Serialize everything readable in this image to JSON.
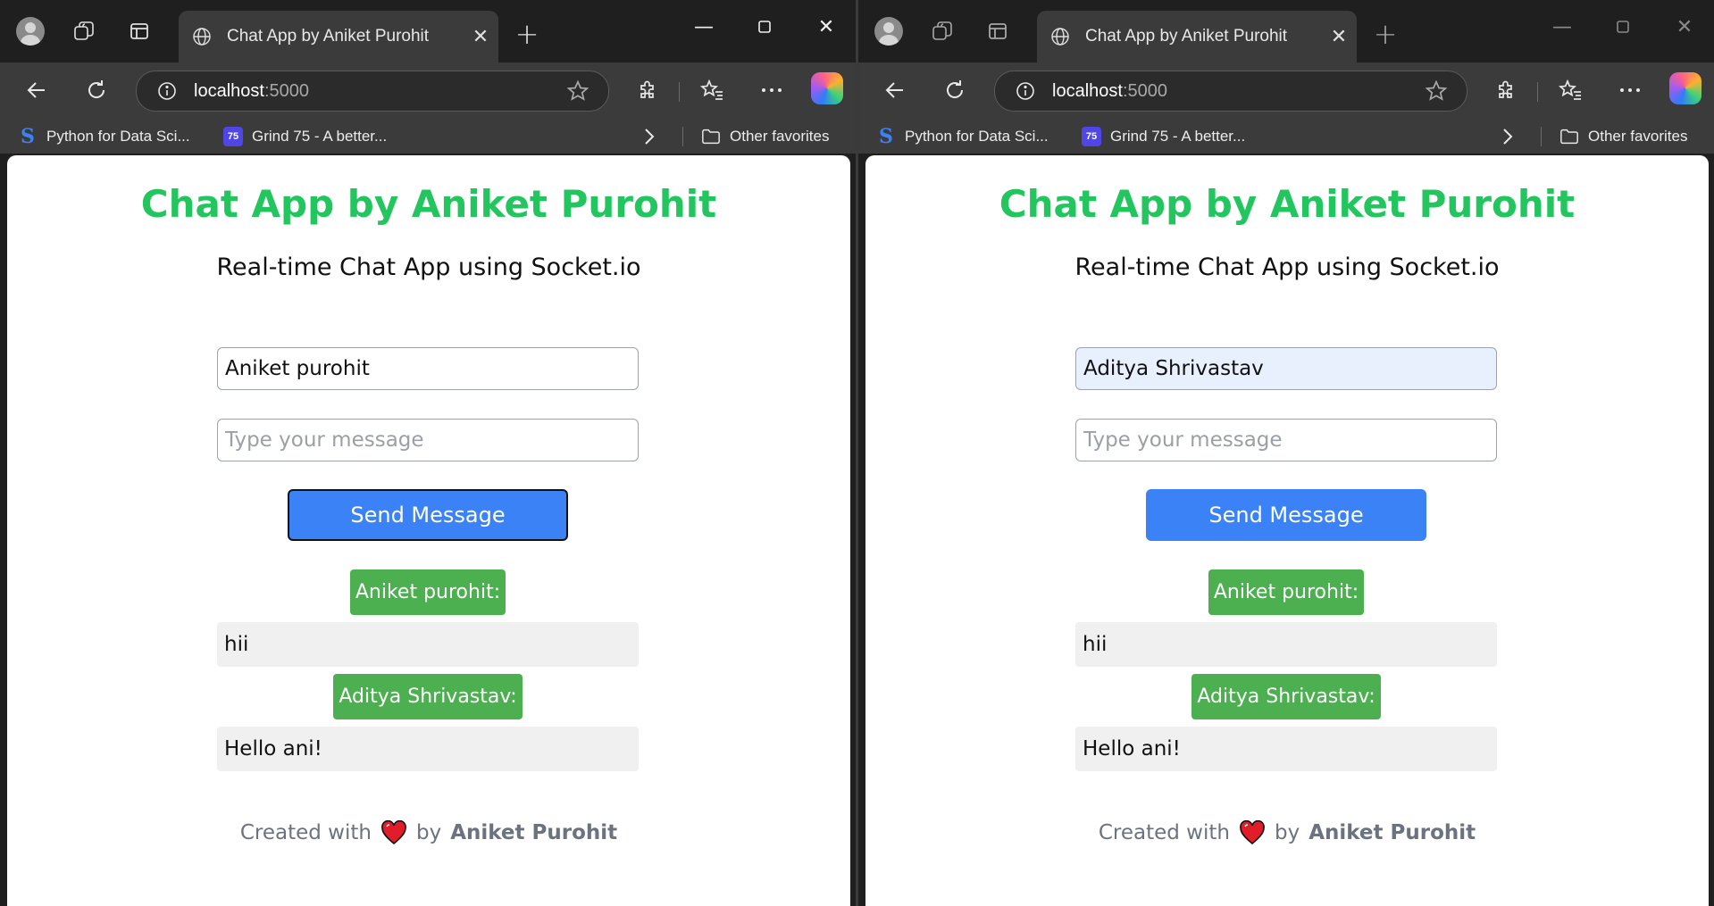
{
  "windows": [
    {
      "id": "left",
      "tab": {
        "title": "Chat App by Aniket Purohit"
      },
      "url": {
        "host": "localhost",
        "port": ":5000"
      },
      "bookmarks": [
        {
          "label": "Python for Data Sci..."
        },
        {
          "label": "Grind 75 - A better...",
          "icon_text": "75"
        }
      ],
      "other_favorites": "Other favorites",
      "app": {
        "title": "Chat App by Aniket Purohit",
        "subtitle": "Real-time Chat App using Socket.io",
        "name_value": "Aniket purohit",
        "message_placeholder": "Type your message",
        "send_label": "Send Message",
        "messages": [
          {
            "sender": "Aniket purohit:",
            "text": "hii"
          },
          {
            "sender": "Aditya Shrivastav:",
            "text": "Hello ani!"
          }
        ],
        "footer": {
          "prefix": "Created with",
          "by": "by",
          "author": "Aniket Purohit"
        }
      }
    },
    {
      "id": "right",
      "tab": {
        "title": "Chat App by Aniket Purohit"
      },
      "url": {
        "host": "localhost",
        "port": ":5000"
      },
      "bookmarks": [
        {
          "label": "Python for Data Sci..."
        },
        {
          "label": "Grind 75 - A better...",
          "icon_text": "75"
        }
      ],
      "other_favorites": "Other favorites",
      "app": {
        "title": "Chat App by Aniket Purohit",
        "subtitle": "Real-time Chat App using Socket.io",
        "name_value": "Aditya Shrivastav",
        "message_placeholder": "Type your message",
        "send_label": "Send Message",
        "messages": [
          {
            "sender": "Aniket purohit:",
            "text": "hii"
          },
          {
            "sender": "Aditya Shrivastav:",
            "text": "Hello ani!"
          }
        ],
        "footer": {
          "prefix": "Created with",
          "by": "by",
          "author": "Aniket Purohit"
        }
      }
    }
  ],
  "colors": {
    "title_green": "#22c55e",
    "send_blue": "#3b82f6",
    "sender_green": "#4caf50",
    "message_bg": "#f0f0f0",
    "browser_dark": "#1f1f1f",
    "browser_toolbar": "#3b3b3b"
  },
  "icons": {
    "profile": "avatar-icon",
    "workspaces": "workspaces-icon",
    "tab_actions": "tab-actions-icon",
    "back": "back-arrow-icon",
    "refresh": "refresh-icon",
    "extensions": "puzzle-icon",
    "favorites": "favorites-star-icon",
    "more": "ellipsis-icon",
    "copilot": "copilot-icon",
    "heart": "heart-icon"
  }
}
